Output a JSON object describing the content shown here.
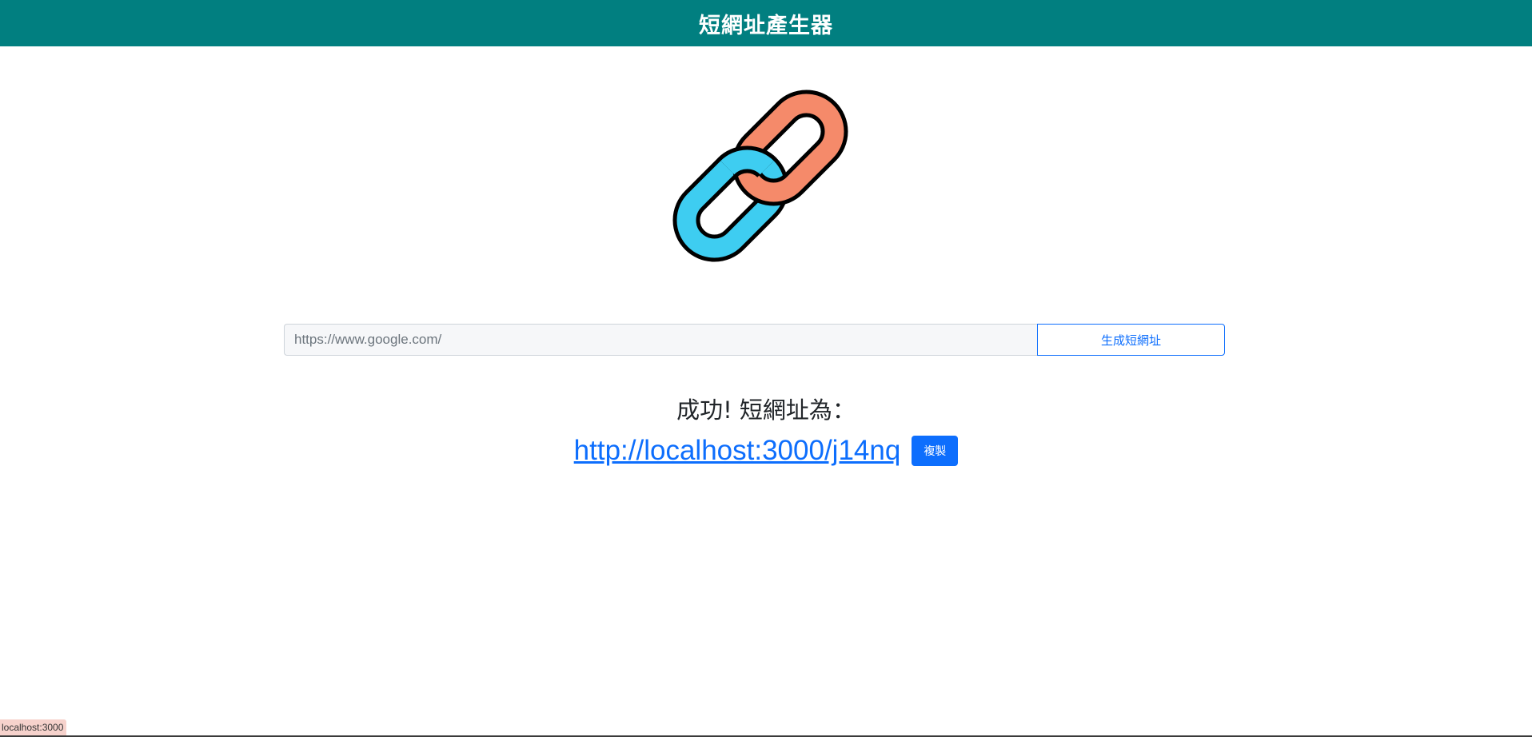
{
  "header": {
    "title": "短網址產生器"
  },
  "logo": {
    "icon": "chain-link-icon",
    "colors": {
      "orange_link": "#f58a6a",
      "blue_link": "#3ecdf1",
      "outline": "#000000"
    }
  },
  "form": {
    "input_value": "https://www.google.com/",
    "submit_label": "生成短網址"
  },
  "result": {
    "success_text": "成功! 短網址為：",
    "short_url": "http://localhost:3000/j14nq",
    "copy_label": "複製"
  },
  "status": {
    "hover_url": "localhost:3000"
  },
  "colors": {
    "header_bg": "#017f80",
    "accent": "#0d6efd"
  }
}
